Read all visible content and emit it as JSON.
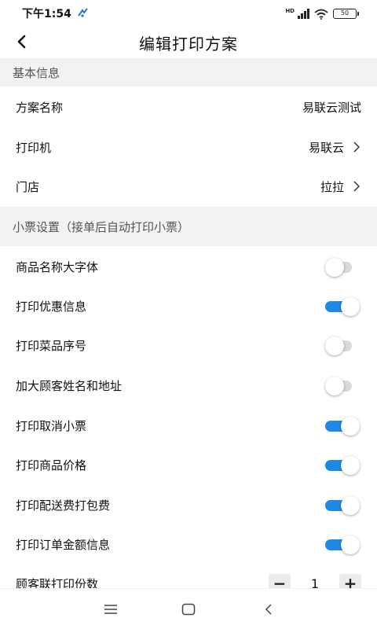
{
  "status": {
    "time": "下午1:54",
    "hd": "HD",
    "battery": "50"
  },
  "nav": {
    "title": "编辑打印方案"
  },
  "basic": {
    "header": "基本信息",
    "rows": [
      {
        "label": "方案名称",
        "value": "易联云测试"
      },
      {
        "label": "打印机",
        "value": "易联云"
      },
      {
        "label": "门店",
        "value": "拉拉"
      }
    ]
  },
  "receipt": {
    "header": "小票设置（接单后自动打印小票）",
    "toggles": [
      {
        "label": "商品名称大字体",
        "on": false
      },
      {
        "label": "打印优惠信息",
        "on": true
      },
      {
        "label": "打印菜品序号",
        "on": false
      },
      {
        "label": "加大顾客姓名和地址",
        "on": false
      },
      {
        "label": "打印取消小票",
        "on": true
      },
      {
        "label": "打印商品价格",
        "on": true
      },
      {
        "label": "打印配送费打包费",
        "on": true
      },
      {
        "label": "打印订单金额信息",
        "on": true
      }
    ],
    "copies": {
      "label": "顾客联打印份数",
      "value": "1",
      "minus": "−",
      "plus": "+"
    }
  },
  "colors": {
    "accent": "#1e88e5",
    "section_bg": "#f2f2f2"
  }
}
